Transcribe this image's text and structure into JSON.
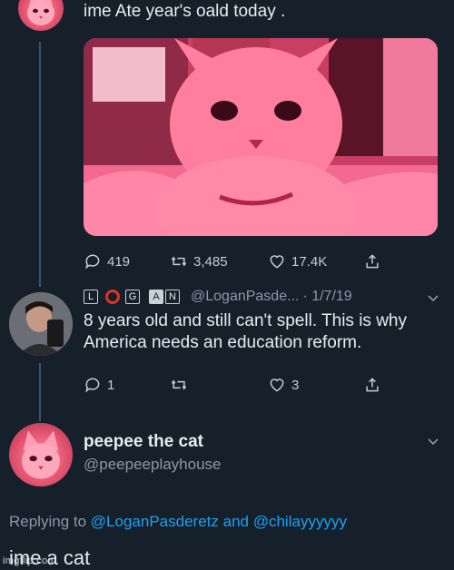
{
  "tweet": {
    "text": "ime Ate year's oald today .",
    "stats": {
      "replies": "419",
      "retweets": "3,485",
      "likes": "17.4K"
    }
  },
  "reply": {
    "badges": [
      "L",
      "G",
      "A",
      "N"
    ],
    "handle": "@LoganPasde...",
    "date": "· 1/7/19",
    "text": "8 years old and still can't spell. This is why America needs an education reform.",
    "stats": {
      "replies": "1",
      "likes": "3"
    }
  },
  "profile": {
    "name": "peepee the cat",
    "handle": "@peepeeplayhouse",
    "replying_prefix": "Replying to",
    "mention1": "@LoganPasderetz",
    "and": "and",
    "mention2": "@chilayyyyyy",
    "text": "ime a cat"
  },
  "watermark": "imgflip.com",
  "colors": {
    "background": "#15202b",
    "link": "#1da1f2",
    "muted": "#8b98a5"
  }
}
